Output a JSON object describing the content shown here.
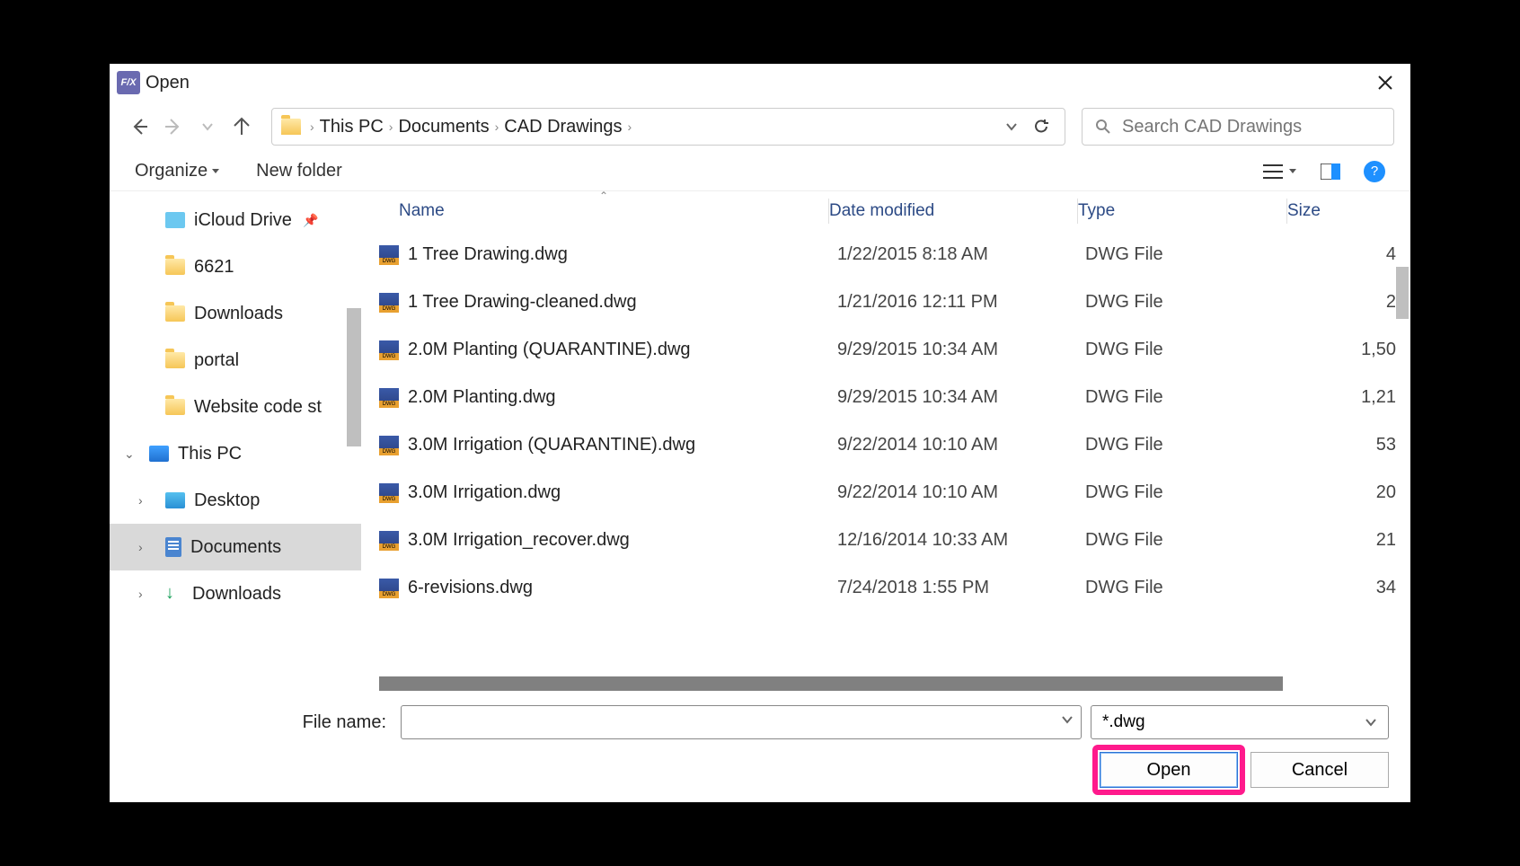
{
  "window": {
    "title": "Open",
    "app_badge": "F/X"
  },
  "nav": {
    "breadcrumb": [
      "This PC",
      "Documents",
      "CAD Drawings"
    ],
    "search_placeholder": "Search CAD Drawings"
  },
  "toolbar": {
    "organize": "Organize",
    "new_folder": "New folder"
  },
  "sidebar": {
    "items": [
      {
        "label": "iCloud Drive",
        "icon": "cloud",
        "pinned": true
      },
      {
        "label": "6621",
        "icon": "folder"
      },
      {
        "label": "Downloads",
        "icon": "folder"
      },
      {
        "label": "portal",
        "icon": "folder"
      },
      {
        "label": "Website code st",
        "icon": "folder"
      },
      {
        "label": "This PC",
        "icon": "pc",
        "level0": true,
        "chev": "down"
      },
      {
        "label": "Desktop",
        "icon": "desk",
        "chev": "right"
      },
      {
        "label": "Documents",
        "icon": "doc",
        "chev": "right",
        "selected": true
      },
      {
        "label": "Downloads",
        "icon": "dl",
        "chev": "right"
      }
    ]
  },
  "columns": {
    "name": "Name",
    "date": "Date modified",
    "type": "Type",
    "size": "Size"
  },
  "files": [
    {
      "name": "1 Tree Drawing.dwg",
      "date": "1/22/2015 8:18 AM",
      "type": "DWG File",
      "size": "4"
    },
    {
      "name": "1 Tree Drawing-cleaned.dwg",
      "date": "1/21/2016 12:11 PM",
      "type": "DWG File",
      "size": "2"
    },
    {
      "name": "2.0M Planting (QUARANTINE).dwg",
      "date": "9/29/2015 10:34 AM",
      "type": "DWG File",
      "size": "1,50"
    },
    {
      "name": "2.0M Planting.dwg",
      "date": "9/29/2015 10:34 AM",
      "type": "DWG File",
      "size": "1,21"
    },
    {
      "name": "3.0M Irrigation (QUARANTINE).dwg",
      "date": "9/22/2014 10:10 AM",
      "type": "DWG File",
      "size": "53"
    },
    {
      "name": "3.0M Irrigation.dwg",
      "date": "9/22/2014 10:10 AM",
      "type": "DWG File",
      "size": "20"
    },
    {
      "name": "3.0M Irrigation_recover.dwg",
      "date": "12/16/2014 10:33 AM",
      "type": "DWG File",
      "size": "21"
    },
    {
      "name": "6-revisions.dwg",
      "date": "7/24/2018 1:55 PM",
      "type": "DWG File",
      "size": "34"
    }
  ],
  "footer": {
    "filename_label": "File name:",
    "filename_value": "",
    "filter": "*.dwg",
    "open": "Open",
    "cancel": "Cancel"
  }
}
